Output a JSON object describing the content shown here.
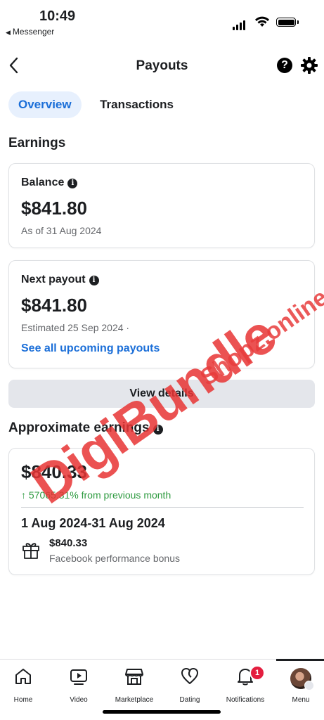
{
  "status_bar": {
    "time": "10:49",
    "back_app": "Messenger"
  },
  "header": {
    "title": "Payouts"
  },
  "tabs": [
    {
      "label": "Overview"
    },
    {
      "label": "Transactions"
    }
  ],
  "earnings": {
    "title": "Earnings",
    "balance": {
      "label": "Balance",
      "amount": "$841.80",
      "sub": "As of 31 Aug 2024"
    },
    "next_payout": {
      "label": "Next payout",
      "amount": "$841.80",
      "sub": "Estimated 25 Sep 2024 ·",
      "link": "See all upcoming payouts"
    },
    "view_details": "View details"
  },
  "approx": {
    "title": "Approximate earnings",
    "amount": "$840.33",
    "growth": "↑ 57065.31% from previous month",
    "period": "1 Aug 2024-31 Aug 2024",
    "bonus_amount": "$840.33",
    "bonus_desc": "Facebook performance bonus"
  },
  "watermark": {
    "main": "DigiBundle",
    "secondary": "Shopz.online"
  },
  "bottom_nav": [
    {
      "label": "Home"
    },
    {
      "label": "Video"
    },
    {
      "label": "Marketplace"
    },
    {
      "label": "Dating"
    },
    {
      "label": "Notifications",
      "badge": "1"
    },
    {
      "label": "Menu"
    }
  ],
  "colors": {
    "accent": "#1a6ed8",
    "positive": "#2d9a3f",
    "badge": "#e41e3f",
    "watermark": "#e83434"
  }
}
